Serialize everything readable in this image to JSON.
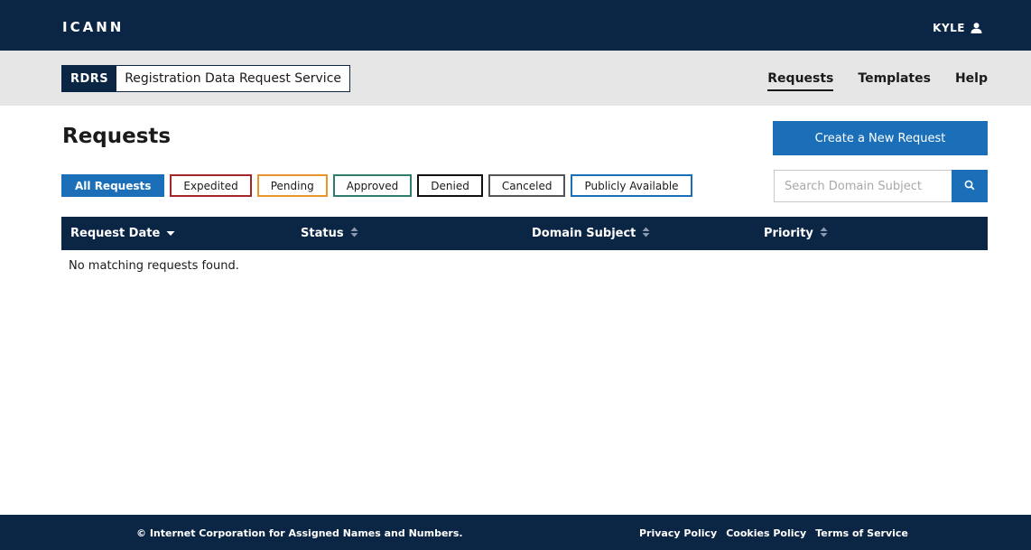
{
  "header": {
    "brand": "ICANN",
    "user": "KYLE"
  },
  "subheader": {
    "badge_code": "RDRS",
    "badge_name": "Registration Data Request Service",
    "nav": [
      {
        "label": "Requests",
        "active": true
      },
      {
        "label": "Templates",
        "active": false
      },
      {
        "label": "Help",
        "active": false
      }
    ]
  },
  "main": {
    "title": "Requests",
    "create_label": "Create a New Request",
    "filters": [
      {
        "label": "All Requests",
        "color": "#1a6fb8",
        "active": true
      },
      {
        "label": "Expedited",
        "color": "#a4262c"
      },
      {
        "label": "Pending",
        "color": "#e8952c"
      },
      {
        "label": "Approved",
        "color": "#2f7d6d"
      },
      {
        "label": "Denied",
        "color": "#111111"
      },
      {
        "label": "Canceled",
        "color": "#555555"
      },
      {
        "label": "Publicly Available",
        "color": "#1a6fb8"
      }
    ],
    "search": {
      "placeholder": "Search Domain Subject",
      "value": ""
    },
    "table": {
      "columns": [
        {
          "label": "Request Date",
          "sort": "desc"
        },
        {
          "label": "Status",
          "sort": "none"
        },
        {
          "label": "Domain Subject",
          "sort": "none"
        },
        {
          "label": "Priority",
          "sort": "none"
        }
      ],
      "empty_message": "No matching requests found."
    }
  },
  "footer": {
    "copyright": "© Internet Corporation for Assigned Names and Numbers.",
    "links": [
      "Privacy Policy",
      "Cookies Policy",
      "Terms of Service"
    ]
  },
  "colors": {
    "navy": "#0b2545",
    "accent": "#1a6fb8",
    "subbar": "#e6e6e6"
  },
  "icons": {
    "user": "user-icon",
    "search": "search-icon",
    "sort": "sort-icon"
  }
}
